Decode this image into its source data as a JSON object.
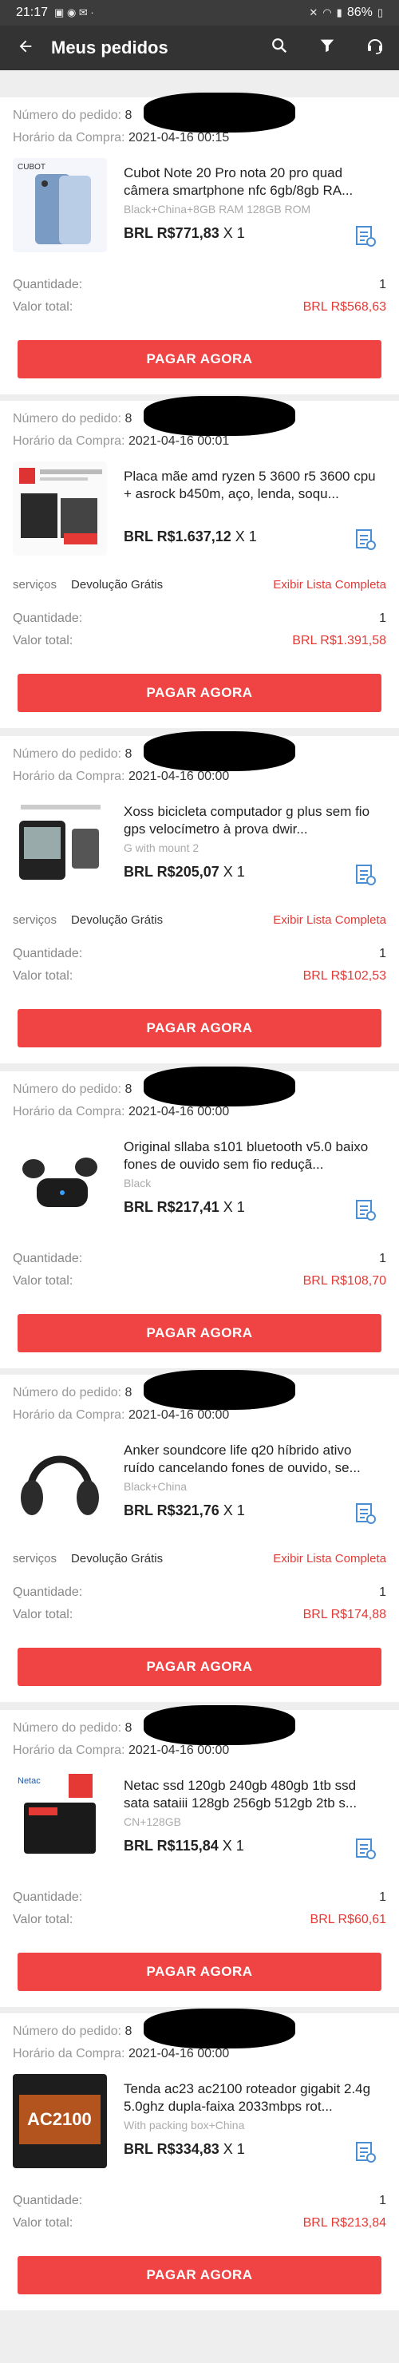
{
  "status_bar": {
    "time": "21:17",
    "battery": "86%"
  },
  "header": {
    "title": "Meus pedidos"
  },
  "labels": {
    "order_number": "Número do pedido:",
    "order_time": "Horário da Compra:",
    "services": "serviços",
    "quantity": "Quantidade:",
    "total": "Valor total:",
    "pay_button": "PAGAR AGORA"
  },
  "orders": [
    {
      "order_prefix": "8",
      "date": "2021-04-16 00:15",
      "title": "Cubot Note 20 Pro nota 20 pro quad câmera smartphone nfc 6gb/8gb RA...",
      "variant": "Black+China+8GB RAM 128GB ROM",
      "price": "BRL R$771,83",
      "qty_suffix": "X 1",
      "service_value": "",
      "service_link": "",
      "quantity": "1",
      "total": "BRL R$568,63"
    },
    {
      "order_prefix": "8",
      "date": "2021-04-16 00:01",
      "title": "Placa mãe amd ryzen 5 3600 r5 3600 cpu + asrock b450m, aço, lenda, soqu...",
      "variant": "",
      "price": "BRL R$1.637,12",
      "qty_suffix": "X 1",
      "service_value": "Devolução Grátis",
      "service_link": "Exibir Lista Completa",
      "quantity": "1",
      "total": "BRL R$1.391,58"
    },
    {
      "order_prefix": "8",
      "date": "2021-04-16 00:00",
      "title": "Xoss bicicleta computador g plus sem fio gps velocímetro à prova dwir...",
      "variant": "G with mount 2",
      "price": "BRL R$205,07",
      "qty_suffix": "X 1",
      "service_value": "Devolução Grátis",
      "service_link": "Exibir Lista Completa",
      "quantity": "1",
      "total": "BRL R$102,53"
    },
    {
      "order_prefix": "8",
      "date": "2021-04-16 00:00",
      "title": "Original sllaba s101 bluetooth v5.0 baixo fones de ouvido sem fio reduçã...",
      "variant": "Black",
      "price": "BRL R$217,41",
      "qty_suffix": "X 1",
      "service_value": "",
      "service_link": "",
      "quantity": "1",
      "total": "BRL R$108,70"
    },
    {
      "order_prefix": "8",
      "date": "2021-04-16 00:00",
      "title": "Anker soundcore life q20 híbrido ativo ruído cancelando fones de ouvido, se...",
      "variant": "Black+China",
      "price": "BRL R$321,76",
      "qty_suffix": "X 1",
      "service_value": "Devolução Grátis",
      "service_link": "Exibir Lista Completa",
      "quantity": "1",
      "total": "BRL R$174,88"
    },
    {
      "order_prefix": "8",
      "date": "2021-04-16 00:00",
      "title": "Netac ssd 120gb 240gb 480gb 1tb ssd sata sataiii 128gb 256gb 512gb 2tb s...",
      "variant": "CN+128GB",
      "price": "BRL R$115,84",
      "qty_suffix": "X 1",
      "service_value": "",
      "service_link": "",
      "quantity": "1",
      "total": "BRL R$60,61"
    },
    {
      "order_prefix": "8",
      "date": "2021-04-16 00:00",
      "title": "Tenda ac23 ac2100 roteador gigabit 2.4g 5.0ghz dupla-faixa 2033mbps rot...",
      "variant": "With packing box+China",
      "price": "BRL R$334,83",
      "qty_suffix": "X 1",
      "service_value": "",
      "service_link": "",
      "quantity": "1",
      "total": "BRL R$213,84"
    }
  ],
  "thumb_texts": {
    "o1": "CUBOT",
    "o6": "Netac",
    "o7": "AC2100"
  },
  "colors": {
    "header": "#333333",
    "status": "#3c3c3c",
    "accent": "#f04343",
    "price_red": "#e53935"
  }
}
